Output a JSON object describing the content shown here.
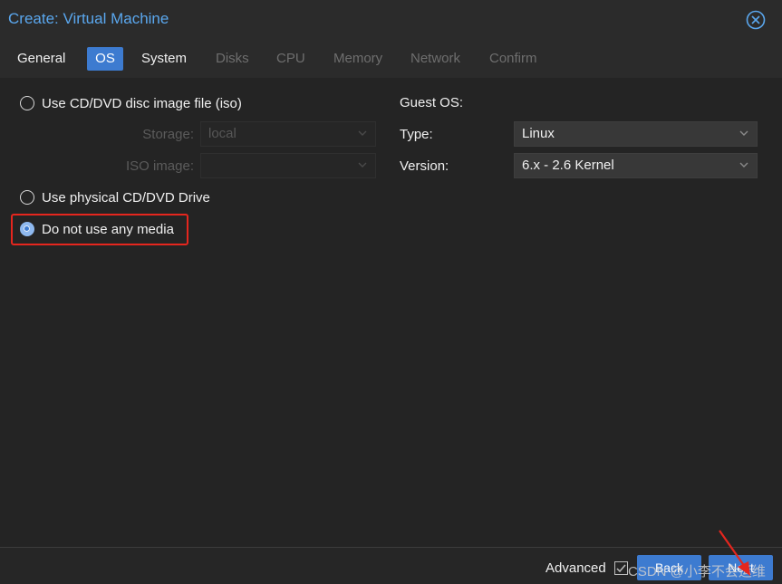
{
  "window": {
    "title": "Create: Virtual Machine"
  },
  "tabs": [
    {
      "label": "General",
      "state": "normal"
    },
    {
      "label": "OS",
      "state": "active"
    },
    {
      "label": "System",
      "state": "normal"
    },
    {
      "label": "Disks",
      "state": "disabled"
    },
    {
      "label": "CPU",
      "state": "disabled"
    },
    {
      "label": "Memory",
      "state": "disabled"
    },
    {
      "label": "Network",
      "state": "disabled"
    },
    {
      "label": "Confirm",
      "state": "disabled"
    }
  ],
  "media": {
    "option_iso": "Use CD/DVD disc image file (iso)",
    "storage_label": "Storage:",
    "storage_value": "local",
    "iso_label": "ISO image:",
    "iso_value": "",
    "option_physical": "Use physical CD/DVD Drive",
    "option_none": "Do not use any media",
    "selected": "none"
  },
  "guest_os": {
    "heading": "Guest OS:",
    "type_label": "Type:",
    "type_value": "Linux",
    "version_label": "Version:",
    "version_value": "6.x - 2.6 Kernel"
  },
  "footer": {
    "advanced_label": "Advanced",
    "advanced_checked": true,
    "back_label": "Back",
    "next_label": "Next",
    "watermark": "CSDN @小李不会运维"
  },
  "colors": {
    "accent": "#3d7bd0",
    "title": "#5aa7ee",
    "highlight": "#e5261e"
  }
}
